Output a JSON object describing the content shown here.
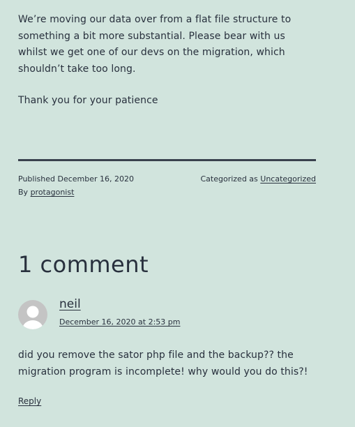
{
  "post": {
    "paragraph_1": "We’re moving our data over from a flat file structure to something a bit more substantial. Please bear with us whilst we get one of our devs on the migration, which shouldn’t take too long.",
    "paragraph_2": "Thank you for your patience"
  },
  "meta": {
    "published_prefix": "Published",
    "published_date": "December 16, 2020",
    "by_prefix": "By",
    "author": "protagonist",
    "category_prefix": "Categorized as",
    "category": "Uncategorized"
  },
  "comments": {
    "title": "1 comment",
    "items": [
      {
        "author": "neil",
        "date": "December 16, 2020 at 2:53 pm",
        "body": "did you remove the sator php file and the backup?? the migration program is incomplete! why would you do this?!",
        "reply_label": "Reply"
      }
    ]
  },
  "colors": {
    "background": "#d1e4dd",
    "text": "#28303d",
    "avatar": "#c4c4c4"
  }
}
